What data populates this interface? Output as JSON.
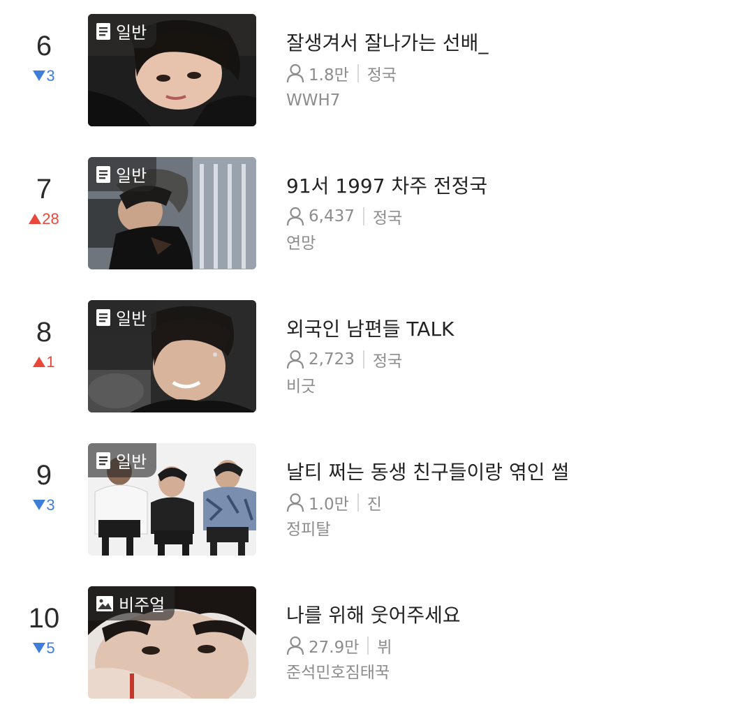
{
  "items": [
    {
      "rank": "6",
      "change": "3",
      "direction": "down",
      "badge": "일반",
      "badge_icon": "document-icon",
      "title": "잘생겨서 잘나가는 선배_",
      "views": "1.8만",
      "member": "정국",
      "author": "WWH7",
      "thumb_theme": "dark-portrait"
    },
    {
      "rank": "7",
      "change": "28",
      "direction": "up",
      "badge": "일반",
      "badge_icon": "document-icon",
      "title": "91서 1997 차주 전정국",
      "views": "6,437",
      "member": "정국",
      "author": "연망",
      "thumb_theme": "backstage"
    },
    {
      "rank": "8",
      "change": "1",
      "direction": "up",
      "badge": "일반",
      "badge_icon": "document-icon",
      "title": "외국인 남편들 TALK",
      "views": "2,723",
      "member": "정국",
      "author": "비긋",
      "thumb_theme": "smile"
    },
    {
      "rank": "9",
      "change": "3",
      "direction": "down",
      "badge": "일반",
      "badge_icon": "document-icon",
      "title": "날티 쩌는 동생 친구들이랑 엮인 썰",
      "views": "1.0만",
      "member": "진",
      "author": "정피탈",
      "thumb_theme": "group-of-three"
    },
    {
      "rank": "10",
      "change": "5",
      "direction": "down",
      "badge": "비주얼",
      "badge_icon": "image-icon",
      "title": "나를 위해 웃어주세요",
      "views": "27.9만",
      "member": "뷔",
      "author": "준석민호짐태꾹",
      "thumb_theme": "close-up"
    }
  ],
  "colors": {
    "down": "#3f7ed8",
    "up": "#e8483b",
    "meta": "#8c8c8c",
    "title": "#222222"
  }
}
